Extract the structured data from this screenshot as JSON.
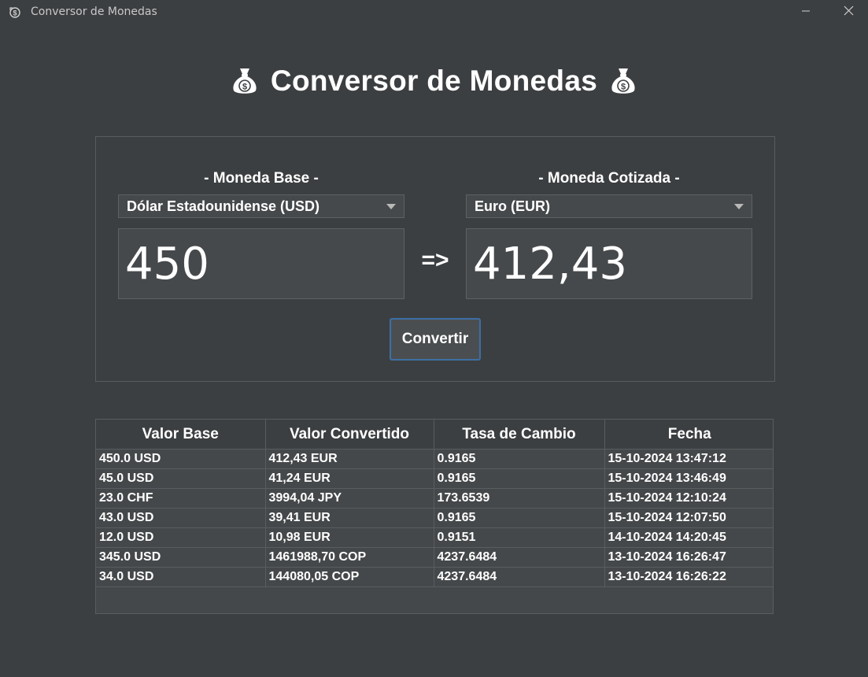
{
  "window": {
    "title": "Conversor de Monedas",
    "icons": {
      "app": "dollar-cycle-icon",
      "minimize": "minimize-icon",
      "close": "close-icon"
    }
  },
  "header": {
    "title": "Conversor de Monedas",
    "icon": "money-bag-icon"
  },
  "converter": {
    "base": {
      "label": "- Moneda Base -",
      "selected": "Dólar Estadounidense (USD)",
      "amount": "450"
    },
    "quote": {
      "label": "- Moneda Cotizada -",
      "selected": "Euro (EUR)",
      "amount": "412,43"
    },
    "arrow": "=>",
    "convert_label": "Convertir",
    "colors": {
      "button_border": "#3d6fa6"
    }
  },
  "history": {
    "columns": [
      "Valor Base",
      "Valor Convertido",
      "Tasa de Cambio",
      "Fecha"
    ],
    "rows": [
      [
        "450.0 USD",
        "412,43 EUR",
        "0.9165",
        "15-10-2024 13:47:12"
      ],
      [
        "45.0 USD",
        "41,24 EUR",
        "0.9165",
        "15-10-2024 13:46:49"
      ],
      [
        "23.0 CHF",
        "3994,04 JPY",
        "173.6539",
        "15-10-2024 12:10:24"
      ],
      [
        "43.0 USD",
        "39,41 EUR",
        "0.9165",
        "15-10-2024 12:07:50"
      ],
      [
        "12.0 USD",
        "10,98 EUR",
        "0.9151",
        "14-10-2024 14:20:45"
      ],
      [
        "345.0 USD",
        "1461988,70 COP",
        "4237.6484",
        "13-10-2024 16:26:47"
      ],
      [
        "34.0 USD",
        "144080,05 COP",
        "4237.6484",
        "13-10-2024 16:26:22"
      ]
    ]
  }
}
